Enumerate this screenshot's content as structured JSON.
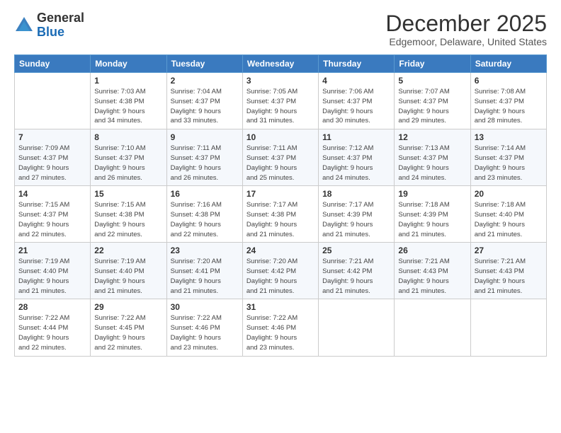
{
  "logo": {
    "general": "General",
    "blue": "Blue"
  },
  "header": {
    "month": "December 2025",
    "location": "Edgemoor, Delaware, United States"
  },
  "weekdays": [
    "Sunday",
    "Monday",
    "Tuesday",
    "Wednesday",
    "Thursday",
    "Friday",
    "Saturday"
  ],
  "weeks": [
    [
      {
        "num": "",
        "empty": true
      },
      {
        "num": "1",
        "sunrise": "7:03 AM",
        "sunset": "4:38 PM",
        "daylight": "9 hours and 34 minutes."
      },
      {
        "num": "2",
        "sunrise": "7:04 AM",
        "sunset": "4:37 PM",
        "daylight": "9 hours and 33 minutes."
      },
      {
        "num": "3",
        "sunrise": "7:05 AM",
        "sunset": "4:37 PM",
        "daylight": "9 hours and 31 minutes."
      },
      {
        "num": "4",
        "sunrise": "7:06 AM",
        "sunset": "4:37 PM",
        "daylight": "9 hours and 30 minutes."
      },
      {
        "num": "5",
        "sunrise": "7:07 AM",
        "sunset": "4:37 PM",
        "daylight": "9 hours and 29 minutes."
      },
      {
        "num": "6",
        "sunrise": "7:08 AM",
        "sunset": "4:37 PM",
        "daylight": "9 hours and 28 minutes."
      }
    ],
    [
      {
        "num": "7",
        "sunrise": "7:09 AM",
        "sunset": "4:37 PM",
        "daylight": "9 hours and 27 minutes."
      },
      {
        "num": "8",
        "sunrise": "7:10 AM",
        "sunset": "4:37 PM",
        "daylight": "9 hours and 26 minutes."
      },
      {
        "num": "9",
        "sunrise": "7:11 AM",
        "sunset": "4:37 PM",
        "daylight": "9 hours and 26 minutes."
      },
      {
        "num": "10",
        "sunrise": "7:11 AM",
        "sunset": "4:37 PM",
        "daylight": "9 hours and 25 minutes."
      },
      {
        "num": "11",
        "sunrise": "7:12 AM",
        "sunset": "4:37 PM",
        "daylight": "9 hours and 24 minutes."
      },
      {
        "num": "12",
        "sunrise": "7:13 AM",
        "sunset": "4:37 PM",
        "daylight": "9 hours and 24 minutes."
      },
      {
        "num": "13",
        "sunrise": "7:14 AM",
        "sunset": "4:37 PM",
        "daylight": "9 hours and 23 minutes."
      }
    ],
    [
      {
        "num": "14",
        "sunrise": "7:15 AM",
        "sunset": "4:37 PM",
        "daylight": "9 hours and 22 minutes."
      },
      {
        "num": "15",
        "sunrise": "7:15 AM",
        "sunset": "4:38 PM",
        "daylight": "9 hours and 22 minutes."
      },
      {
        "num": "16",
        "sunrise": "7:16 AM",
        "sunset": "4:38 PM",
        "daylight": "9 hours and 22 minutes."
      },
      {
        "num": "17",
        "sunrise": "7:17 AM",
        "sunset": "4:38 PM",
        "daylight": "9 hours and 21 minutes."
      },
      {
        "num": "18",
        "sunrise": "7:17 AM",
        "sunset": "4:39 PM",
        "daylight": "9 hours and 21 minutes."
      },
      {
        "num": "19",
        "sunrise": "7:18 AM",
        "sunset": "4:39 PM",
        "daylight": "9 hours and 21 minutes."
      },
      {
        "num": "20",
        "sunrise": "7:18 AM",
        "sunset": "4:40 PM",
        "daylight": "9 hours and 21 minutes."
      }
    ],
    [
      {
        "num": "21",
        "sunrise": "7:19 AM",
        "sunset": "4:40 PM",
        "daylight": "9 hours and 21 minutes."
      },
      {
        "num": "22",
        "sunrise": "7:19 AM",
        "sunset": "4:40 PM",
        "daylight": "9 hours and 21 minutes."
      },
      {
        "num": "23",
        "sunrise": "7:20 AM",
        "sunset": "4:41 PM",
        "daylight": "9 hours and 21 minutes."
      },
      {
        "num": "24",
        "sunrise": "7:20 AM",
        "sunset": "4:42 PM",
        "daylight": "9 hours and 21 minutes."
      },
      {
        "num": "25",
        "sunrise": "7:21 AM",
        "sunset": "4:42 PM",
        "daylight": "9 hours and 21 minutes."
      },
      {
        "num": "26",
        "sunrise": "7:21 AM",
        "sunset": "4:43 PM",
        "daylight": "9 hours and 21 minutes."
      },
      {
        "num": "27",
        "sunrise": "7:21 AM",
        "sunset": "4:43 PM",
        "daylight": "9 hours and 21 minutes."
      }
    ],
    [
      {
        "num": "28",
        "sunrise": "7:22 AM",
        "sunset": "4:44 PM",
        "daylight": "9 hours and 22 minutes."
      },
      {
        "num": "29",
        "sunrise": "7:22 AM",
        "sunset": "4:45 PM",
        "daylight": "9 hours and 22 minutes."
      },
      {
        "num": "30",
        "sunrise": "7:22 AM",
        "sunset": "4:46 PM",
        "daylight": "9 hours and 23 minutes."
      },
      {
        "num": "31",
        "sunrise": "7:22 AM",
        "sunset": "4:46 PM",
        "daylight": "9 hours and 23 minutes."
      },
      {
        "num": "",
        "empty": true
      },
      {
        "num": "",
        "empty": true
      },
      {
        "num": "",
        "empty": true
      }
    ]
  ],
  "labels": {
    "sunrise": "Sunrise: ",
    "sunset": "Sunset: ",
    "daylight": "Daylight: "
  }
}
